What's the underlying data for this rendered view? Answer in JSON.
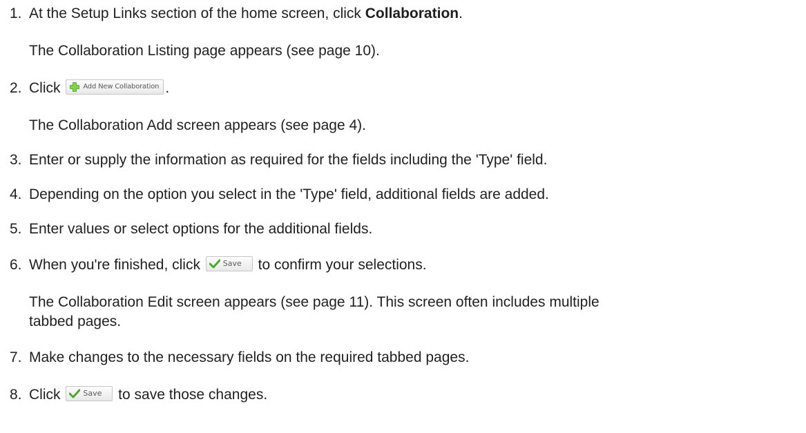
{
  "steps": [
    {
      "number": "1.",
      "pre": "At the Setup Links section of the home screen, click ",
      "bold": "Collaboration",
      "post": ".",
      "result": "The Collaboration Listing page appears (see page 10)."
    },
    {
      "number": "2.",
      "pre": "Click ",
      "button_label": "Add New Collaboration",
      "button_icon": "plus-icon",
      "post": ".",
      "result": "The Collaboration Add screen appears (see page 4)."
    },
    {
      "number": "3.",
      "text": "Enter or supply the information as required for the fields including the 'Type' field."
    },
    {
      "number": "4.",
      "text": "Depending on the option you select in the 'Type' field, additional fields are added."
    },
    {
      "number": "5.",
      "text": "Enter values or select options for the additional fields."
    },
    {
      "number": "6.",
      "pre": "When you're finished, click ",
      "button_label": "Save",
      "button_icon": "check-icon",
      "post": " to confirm your selections.",
      "result_line1": "The Collaboration Edit screen appears (see page 11). This screen often includes multiple",
      "result_line2": "tabbed pages."
    },
    {
      "number": "7.",
      "text": "Make changes to the necessary fields on the required tabbed pages."
    },
    {
      "number": "8.",
      "pre": "Click ",
      "button_label": "Save",
      "button_icon": "check-icon",
      "post": " to save those changes."
    }
  ],
  "colors": {
    "text": "#1f1f1f",
    "plus_green": "#5cb130",
    "check_green": "#4caa2b"
  }
}
